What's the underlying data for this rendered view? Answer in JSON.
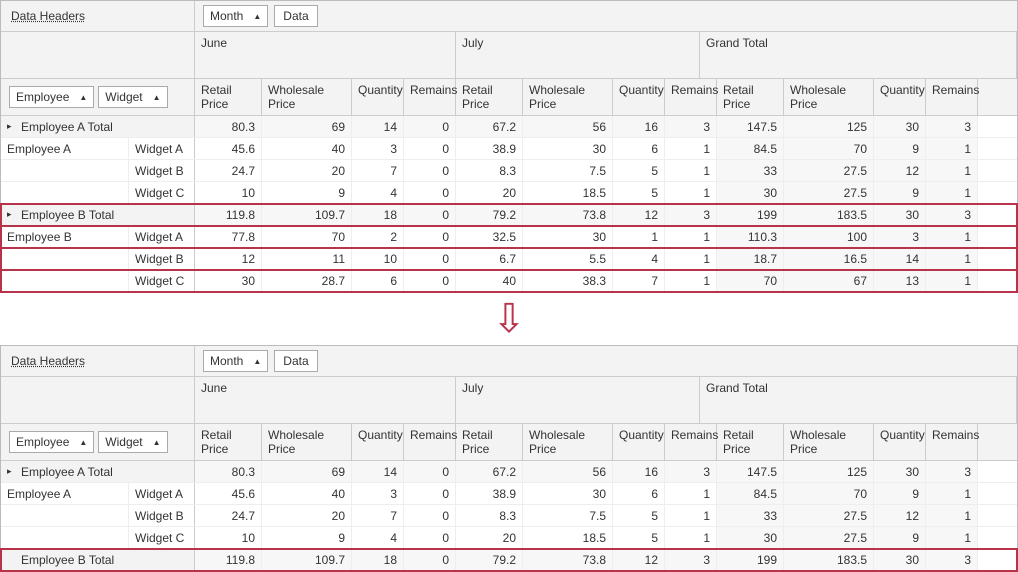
{
  "labels": {
    "data_headers": "Data Headers",
    "employee": "Employee",
    "widget": "Widget",
    "month": "Month",
    "data": "Data",
    "june": "June",
    "july": "July",
    "grand_total": "Grand Total",
    "rp": "Retail Price",
    "wp": "Wholesale Price",
    "qt": "Quantity",
    "rm": "Remains",
    "empA": "Employee A",
    "empB": "Employee B",
    "empA_total": "Employee A Total",
    "empB_total": "Employee B Total",
    "widgetA": "Widget A",
    "widgetB": "Widget B",
    "widgetC": "Widget C"
  },
  "chart_data": {
    "type": "table",
    "columns": [
      "Retail Price",
      "Wholesale Price",
      "Quantity",
      "Remains"
    ],
    "column_groups": [
      "June",
      "July",
      "Grand Total"
    ],
    "rows": [
      {
        "label": "Employee A Total",
        "kind": "total",
        "june": [
          80.3,
          69,
          14,
          0
        ],
        "july": [
          67.2,
          56,
          16,
          3
        ],
        "gt": [
          147.5,
          125,
          30,
          3
        ]
      },
      {
        "employee": "Employee A",
        "widget": "Widget A",
        "june": [
          45.6,
          40,
          3,
          0
        ],
        "july": [
          38.9,
          30,
          6,
          1
        ],
        "gt": [
          84.5,
          70,
          9,
          1
        ]
      },
      {
        "employee": "Employee A",
        "widget": "Widget B",
        "june": [
          24.7,
          20,
          7,
          0
        ],
        "july": [
          8.3,
          7.5,
          5,
          1
        ],
        "gt": [
          33,
          27.5,
          12,
          1
        ]
      },
      {
        "employee": "Employee A",
        "widget": "Widget C",
        "june": [
          10,
          9,
          4,
          0
        ],
        "july": [
          20,
          18.5,
          5,
          1
        ],
        "gt": [
          30,
          27.5,
          9,
          1
        ]
      },
      {
        "label": "Employee B Total",
        "kind": "total",
        "june": [
          119.8,
          109.7,
          18,
          0
        ],
        "july": [
          79.2,
          73.8,
          12,
          3
        ],
        "gt": [
          199,
          183.5,
          30,
          3
        ]
      },
      {
        "employee": "Employee B",
        "widget": "Widget A",
        "june": [
          77.8,
          70,
          2,
          0
        ],
        "july": [
          32.5,
          30,
          1,
          1
        ],
        "gt": [
          110.3,
          100,
          3,
          1
        ]
      },
      {
        "employee": "Employee B",
        "widget": "Widget B",
        "june": [
          12,
          11,
          10,
          0
        ],
        "july": [
          6.7,
          5.5,
          4,
          1
        ],
        "gt": [
          18.7,
          16.5,
          14,
          1
        ]
      },
      {
        "employee": "Employee B",
        "widget": "Widget C",
        "june": [
          30,
          28.7,
          6,
          0
        ],
        "july": [
          40,
          38.3,
          7,
          1
        ],
        "gt": [
          70,
          67,
          13,
          1
        ]
      }
    ]
  },
  "grids": [
    {
      "show_rows": [
        0,
        1,
        2,
        3,
        4,
        5,
        6,
        7
      ],
      "highlight_from": 4,
      "highlight_to": 7,
      "empB_expander": "▸",
      "empB_has_expander": true
    },
    {
      "show_rows": [
        0,
        1,
        2,
        3,
        4
      ],
      "highlight_from": 4,
      "highlight_to": 4,
      "empB_has_expander": false
    }
  ]
}
